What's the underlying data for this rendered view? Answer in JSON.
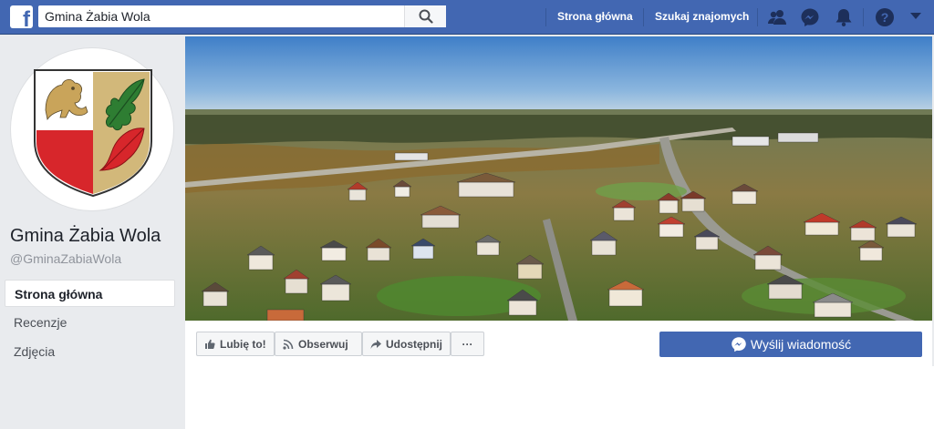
{
  "topbar": {
    "logo_letter": "f",
    "search_value": "Gmina Żabia Wola",
    "nav": [
      "Strona główna",
      "Szukaj znajomych"
    ],
    "icons": [
      "friends-icon",
      "messenger-icon",
      "notifications-icon",
      "help-icon",
      "account-menu-icon"
    ]
  },
  "page": {
    "name": "Gmina Żabia Wola",
    "handle": "@GminaZabiaWola"
  },
  "sidebar": {
    "items": [
      {
        "label": "Strona główna",
        "active": true
      },
      {
        "label": "Recenzje",
        "active": false
      },
      {
        "label": "Zdjęcia",
        "active": false
      }
    ]
  },
  "actions": {
    "like": "Lubię to!",
    "follow": "Obserwuj",
    "share": "Udostępnij",
    "more": "···",
    "message": "Wyślij wiadomość"
  },
  "colors": {
    "brand": "#4267b2",
    "crest_red": "#d7262b",
    "crest_gold": "#d2b87a",
    "leaf_green": "#2e7d32"
  }
}
